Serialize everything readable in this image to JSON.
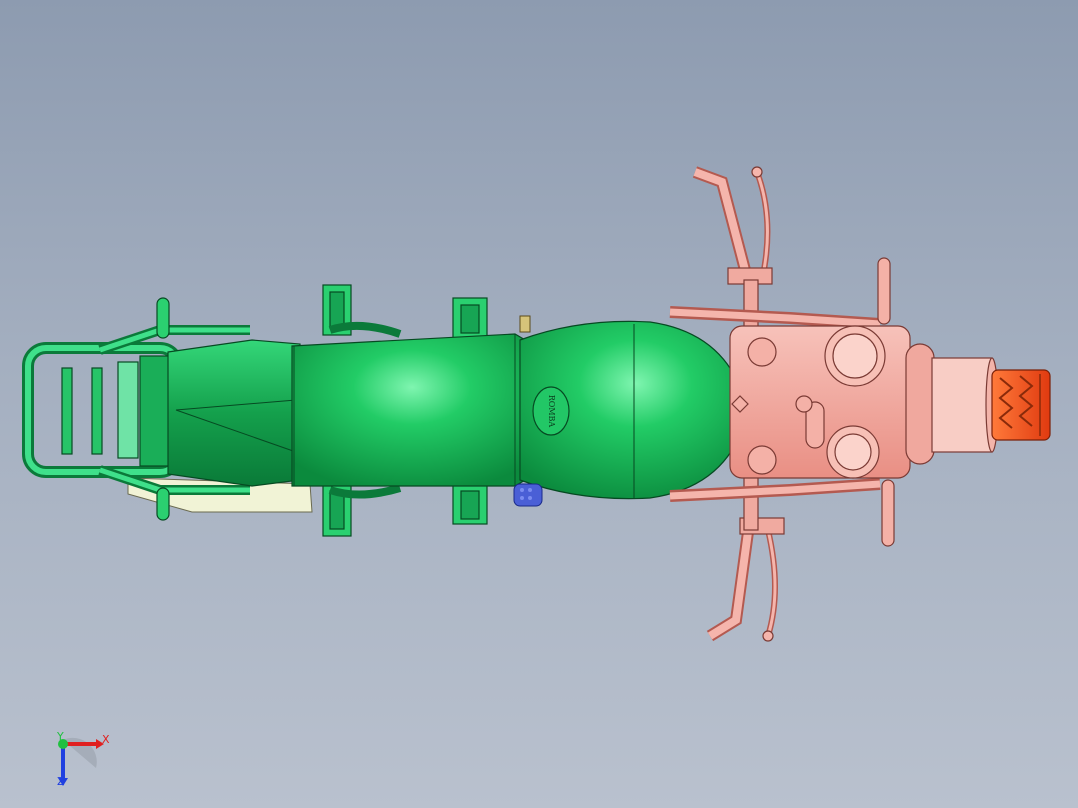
{
  "viewport": {
    "background_top": "#8d9bb0",
    "background_bottom": "#b9c1ce"
  },
  "model": {
    "view": "top",
    "parts": [
      {
        "name": "frame-and-tank",
        "color": "#1fbf5f"
      },
      {
        "name": "front-assembly",
        "color": "#f2a49a"
      },
      {
        "name": "front-tire",
        "color": "#ff5a1f"
      },
      {
        "name": "footrest-pad",
        "color": "#4a5fd6"
      },
      {
        "name": "rear-panel",
        "color": "#f2f4d8"
      }
    ],
    "tank_emblem": "ROMBA"
  },
  "triad": {
    "x_label": "X",
    "y_label": "Y",
    "z_label": "Z",
    "x_color": "#e02020",
    "y_color": "#20c040",
    "z_color": "#2040e0"
  }
}
